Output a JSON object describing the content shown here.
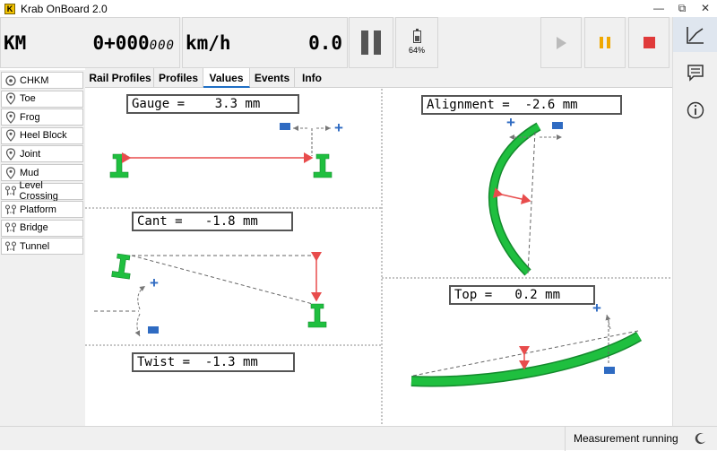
{
  "window": {
    "title": "Krab OnBoard 2.0",
    "icon_letter": "K",
    "minimize": "—",
    "maximize": "⧉",
    "close": "✕"
  },
  "readouts": {
    "km_label": "KM",
    "km_main": "0+000",
    "km_frac": "000",
    "speed_label": "km/h",
    "speed_value": "0.0"
  },
  "battery": {
    "percent_text": "64%",
    "level": 0.64
  },
  "rail_icons": [
    "chart-icon",
    "comment-icon",
    "info-icon"
  ],
  "sidebar": {
    "items": [
      {
        "label": "CHKM",
        "icon": "target-icon"
      },
      {
        "label": "Toe",
        "icon": "pin-icon"
      },
      {
        "label": "Frog",
        "icon": "pin-icon"
      },
      {
        "label": "Heel Block",
        "icon": "pin-icon"
      },
      {
        "label": "Joint",
        "icon": "pin-icon"
      },
      {
        "label": "Mud",
        "icon": "pin-icon"
      },
      {
        "label": "Level Crossing",
        "icon": "range-icon"
      },
      {
        "label": "Platform",
        "icon": "range-icon"
      },
      {
        "label": "Bridge",
        "icon": "range-icon"
      },
      {
        "label": "Tunnel",
        "icon": "range-icon"
      }
    ]
  },
  "tabs": [
    {
      "label": "Rail Profiles",
      "active": false
    },
    {
      "label": "Profiles",
      "active": false
    },
    {
      "label": "Values",
      "active": true
    },
    {
      "label": "Events",
      "active": false
    },
    {
      "label": "Info",
      "active": false
    }
  ],
  "measurements": {
    "gauge": "Gauge =    3.3 mm",
    "cant": "Cant =   -1.8 mm",
    "twist": "Twist =  -1.3 mm",
    "alignment": "Alignment =  -2.6 mm",
    "top": "Top =   0.2 mm"
  },
  "signs": {
    "plus": "+",
    "minus": "−"
  },
  "colors": {
    "rail": "#1fbf3f",
    "arrow": "#e84c4c",
    "sign": "#2f6bc2",
    "dash": "#666666",
    "pause_accent": "#f0a800",
    "stop": "#e03a3a"
  },
  "status": {
    "text": "Measurement running"
  }
}
